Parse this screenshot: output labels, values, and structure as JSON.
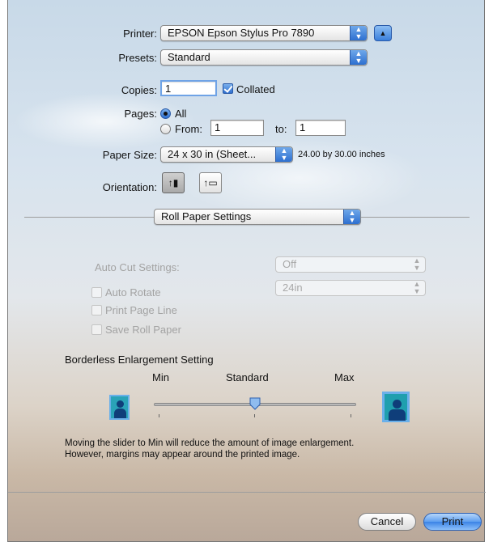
{
  "printer": {
    "label": "Printer:",
    "value": "EPSON Epson Stylus Pro 7890"
  },
  "presets": {
    "label": "Presets:",
    "value": "Standard"
  },
  "copies": {
    "label": "Copies:",
    "value": "1",
    "collated_label": "Collated",
    "collated": true
  },
  "pages": {
    "label": "Pages:",
    "all_label": "All",
    "from_label": "From:",
    "from_value": "1",
    "to_label": "to:",
    "to_value": "1",
    "selected": "All"
  },
  "paper_size": {
    "label": "Paper Size:",
    "value": "24 x 30 in (Sheet...",
    "dimensions": "24.00 by 30.00 inches"
  },
  "orientation": {
    "label": "Orientation:",
    "selected": "portrait"
  },
  "panel": {
    "value": "Roll Paper Settings"
  },
  "roll": {
    "auto_cut_label": "Auto Cut Settings:",
    "auto_cut_value": "Off",
    "auto_rotate_label": "Auto Rotate",
    "auto_rotate_value": "24in",
    "print_page_line_label": "Print Page Line",
    "save_roll_paper_label": "Save Roll Paper"
  },
  "borderless": {
    "title": "Borderless Enlargement Setting",
    "min_label": "Min",
    "standard_label": "Standard",
    "max_label": "Max",
    "slider_level": 0.5,
    "help_line1": "Moving the slider to Min will reduce the amount of image enlargement.",
    "help_line2": "However, margins may appear around the printed image."
  },
  "buttons": {
    "cancel": "Cancel",
    "print": "Print"
  },
  "colors": {
    "accent": "#3b83e6",
    "disabled_text": "#a3a3a3",
    "photo_bg": "#2aa3b8"
  }
}
